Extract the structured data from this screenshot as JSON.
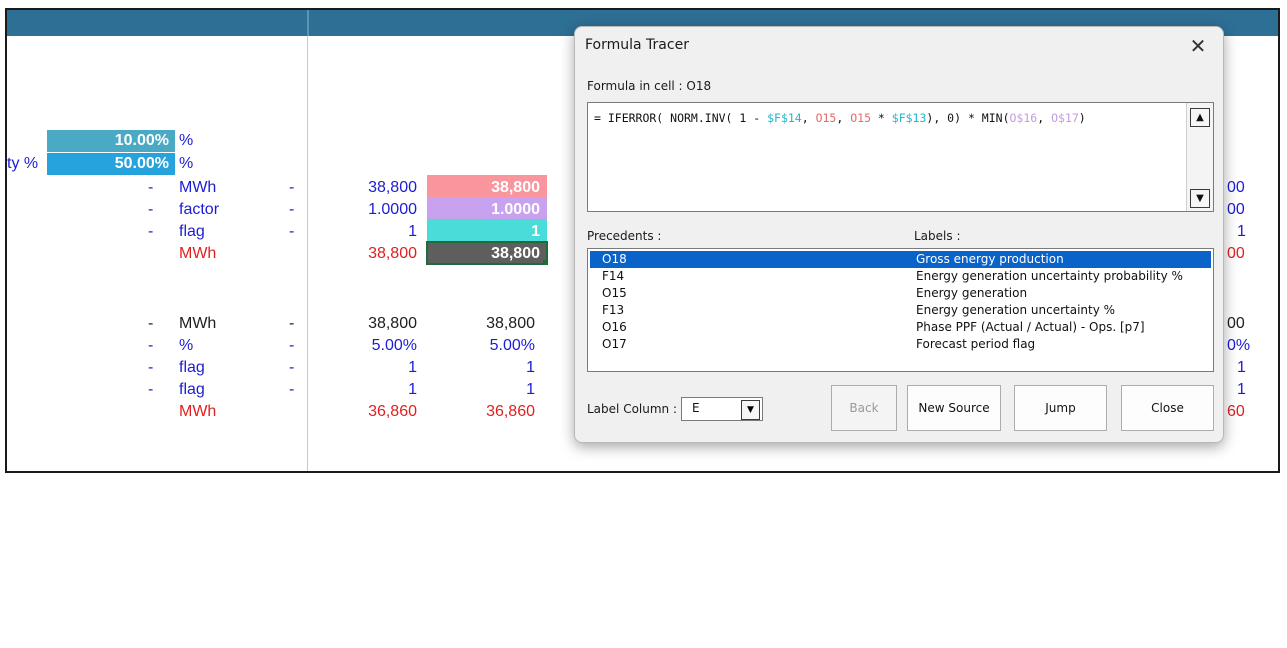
{
  "sheet": {
    "inputs": [
      {
        "prefix": "",
        "value": "10.00%",
        "unit": "%",
        "bg": "#4aa9c4"
      },
      {
        "prefix": "ty %",
        "value": "50.00%",
        "unit": "%",
        "bg": "#26a2dd"
      }
    ],
    "block1": [
      {
        "dash": "-",
        "unit": "MWh",
        "dash2": "-",
        "v1": "38,800",
        "v2": "38,800",
        "right": "00",
        "color": "blue",
        "bg": "#f9969d"
      },
      {
        "dash": "-",
        "unit": "factor",
        "dash2": "-",
        "v1": "1.0000",
        "v2": "1.0000",
        "right": "00",
        "color": "blue",
        "bg": "#c8a2ef"
      },
      {
        "dash": "-",
        "unit": "flag",
        "dash2": "-",
        "v1": "1",
        "v2": "1",
        "right": "1",
        "color": "blue",
        "bg": "#49dcd8"
      },
      {
        "dash": "",
        "unit": "MWh",
        "dash2": "",
        "v1": "38,800",
        "v2": "38,800",
        "right": "00",
        "color": "red",
        "bg": "#5e5e5e"
      }
    ],
    "block2": [
      {
        "dash": "-",
        "unit": "MWh",
        "dash2": "-",
        "v1": "38,800",
        "v2": "38,800",
        "right": "00",
        "color": "black"
      },
      {
        "dash": "-",
        "unit": "%",
        "dash2": "-",
        "v1": "5.00%",
        "v2": "5.00%",
        "right": "0%",
        "color": "blue"
      },
      {
        "dash": "-",
        "unit": "flag",
        "dash2": "-",
        "v1": "1",
        "v2": "1",
        "right": "1",
        "color": "blue"
      },
      {
        "dash": "-",
        "unit": "flag",
        "dash2": "-",
        "v1": "1",
        "v2": "1",
        "right": "1",
        "color": "blue"
      },
      {
        "dash": "",
        "unit": "MWh",
        "dash2": "",
        "v1": "36,860",
        "v2": "36,860",
        "right": "60",
        "color": "red"
      }
    ]
  },
  "dialog": {
    "title": "Formula Tracer",
    "close_glyph": "✕",
    "formula_label": "Formula in cell : O18",
    "formula": {
      "p1": "= IFERROR( NORM.INV( 1 - ",
      "f14": "$F$14",
      "p2": ", ",
      "o15a": "O15",
      "p3": ", ",
      "o15b": "O15",
      "p4": " * ",
      "f13": "$F$13",
      "p5": "), 0) * MIN(",
      "o16": "O$16",
      "p6": ", ",
      "o17": "O$17",
      "p7": ")"
    },
    "precedents_header": "Precedents :",
    "labels_header": "Labels :",
    "precedents": [
      {
        "ref": "O18",
        "label": "Gross energy production",
        "selected": true
      },
      {
        "ref": "F14",
        "label": "Energy generation uncertainty probability %",
        "selected": false
      },
      {
        "ref": "O15",
        "label": "Energy generation",
        "selected": false
      },
      {
        "ref": "F13",
        "label": "Energy generation uncertainty %",
        "selected": false
      },
      {
        "ref": "O16",
        "label": "Phase PPF (Actual / Actual) - Ops. [p7]",
        "selected": false
      },
      {
        "ref": "O17",
        "label": "Forecast period flag",
        "selected": false
      }
    ],
    "label_column_label": "Label Column :",
    "label_column_value": "E",
    "buttons": {
      "back": "Back",
      "new_source": "New Source",
      "jump": "Jump",
      "close": "Close"
    }
  }
}
